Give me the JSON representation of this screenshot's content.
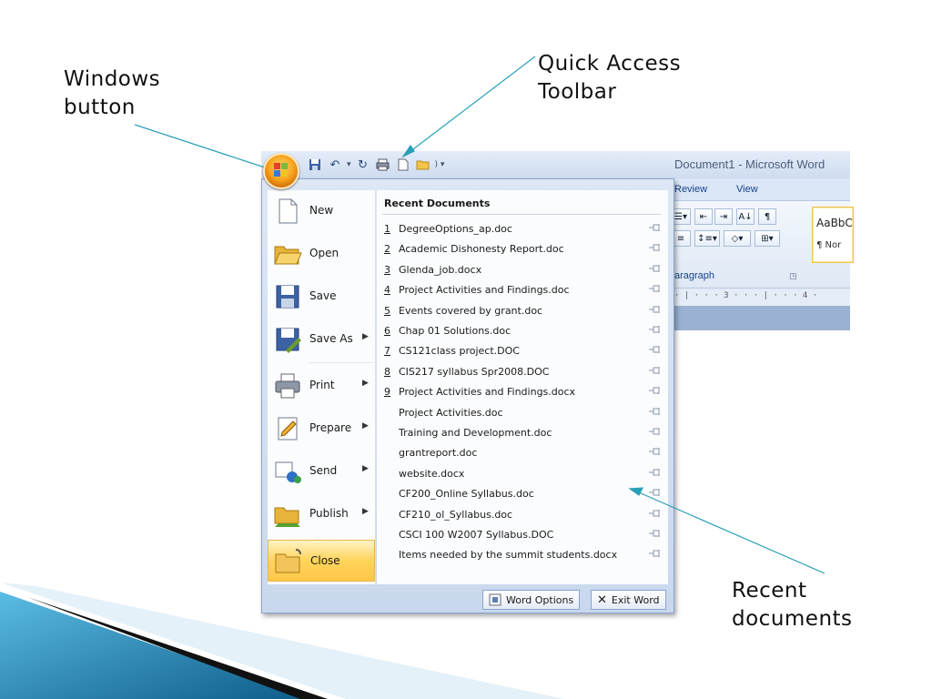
{
  "annotations": {
    "windows_button": [
      "Windows",
      "button"
    ],
    "quick_access_toolbar": [
      "Quick Access",
      "Toolbar"
    ],
    "recent_documents": [
      "Recent",
      "documents"
    ]
  },
  "window": {
    "title": "Document1 - Microsoft Word"
  },
  "ribbon": {
    "tabs": [
      "Review",
      "View"
    ],
    "group_label": "aragraph",
    "style_sample": "AaBbC",
    "style_name": "¶ Nor",
    "ruler": "· | · · · 3 · · · | · · · 4 ·"
  },
  "office_menu": {
    "left_items": [
      {
        "label": "New",
        "has_arrow": false
      },
      {
        "label": "Open",
        "has_arrow": false
      },
      {
        "label": "Save",
        "has_arrow": false
      },
      {
        "label": "Save As",
        "has_arrow": true
      },
      {
        "label": "Print",
        "has_arrow": true
      },
      {
        "label": "Prepare",
        "has_arrow": true
      },
      {
        "label": "Send",
        "has_arrow": true
      },
      {
        "label": "Publish",
        "has_arrow": true
      },
      {
        "label": "Close",
        "has_arrow": false
      }
    ],
    "arrow_glyph": "▶",
    "recent_header": "Recent Documents",
    "recent": [
      {
        "num": "1",
        "name": "DegreeOptions_ap.doc"
      },
      {
        "num": "2",
        "name": "Academic Dishonesty Report.doc"
      },
      {
        "num": "3",
        "name": "Glenda_job.docx"
      },
      {
        "num": "4",
        "name": "Project Activities and Findings.doc"
      },
      {
        "num": "5",
        "name": "Events covered by grant.doc"
      },
      {
        "num": "6",
        "name": "Chap 01 Solutions.doc"
      },
      {
        "num": "7",
        "name": "CS121class project.DOC"
      },
      {
        "num": "8",
        "name": "CIS217 syllabus Spr2008.DOC"
      },
      {
        "num": "9",
        "name": "Project Activities and Findings.docx"
      },
      {
        "num": "",
        "name": "Project Activities.doc"
      },
      {
        "num": "",
        "name": "Training and Development.doc"
      },
      {
        "num": "",
        "name": "grantreport.doc"
      },
      {
        "num": "",
        "name": "website.docx"
      },
      {
        "num": "",
        "name": "CF200_Online Syllabus.doc"
      },
      {
        "num": "",
        "name": "CF210_ol_Syllabus.doc"
      },
      {
        "num": "",
        "name": "CSCI 100 W2007 Syllabus.DOC"
      },
      {
        "num": "",
        "name": "Items needed by the summit students.docx"
      }
    ],
    "footer": {
      "word_options": "Word Options",
      "exit_word": "Exit Word"
    }
  },
  "colors": {
    "menu_highlight": "#ffd45a",
    "annotation_line": "#2aa0b8",
    "wedge_dark": "#0b4a6e",
    "wedge_light": "#3fa8d6"
  }
}
